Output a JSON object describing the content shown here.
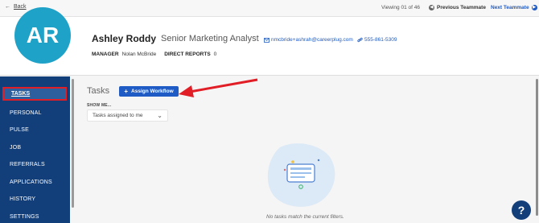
{
  "topbar": {
    "back_label": "Back",
    "viewing": "Viewing 01 of 46",
    "prev_label": "Previous Teammate",
    "next_label": "Next Teammate"
  },
  "profile": {
    "initials": "AR",
    "name": "Ashley Roddy",
    "title": "Senior Marketing Analyst",
    "email": "nmcbride+ashrah@careerplug.com",
    "phone": "555-861-5309",
    "manager_label": "MANAGER",
    "manager_value": "Nolan McBride",
    "reports_label": "DIRECT REPORTS",
    "reports_value": "0"
  },
  "sidebar": {
    "items": [
      {
        "label": "TASKS",
        "active": true
      },
      {
        "label": "PERSONAL"
      },
      {
        "label": "PULSE"
      },
      {
        "label": "JOB"
      },
      {
        "label": "REFERRALS"
      },
      {
        "label": "APPLICATIONS"
      },
      {
        "label": "HISTORY"
      },
      {
        "label": "SETTINGS"
      }
    ]
  },
  "main": {
    "title": "Tasks",
    "assign_button": "Assign Workflow",
    "show_me_label": "SHOW ME...",
    "filter_value": "Tasks assigned to me",
    "empty_text": "No tasks match the current filters."
  },
  "help": {
    "label": "?"
  },
  "colors": {
    "brand_blue": "#1f5bc4",
    "sidebar_navy": "#123f7a",
    "avatar_teal": "#1fa2c8",
    "highlight_red": "#e11d26"
  },
  "icons": [
    "arrow-left-icon",
    "arrow-left-circle-icon",
    "arrow-right-circle-icon",
    "envelope-icon",
    "link-icon",
    "plus-icon",
    "chevron-down-icon",
    "empty-tasks-illustration",
    "annotation-arrow",
    "help-icon"
  ]
}
